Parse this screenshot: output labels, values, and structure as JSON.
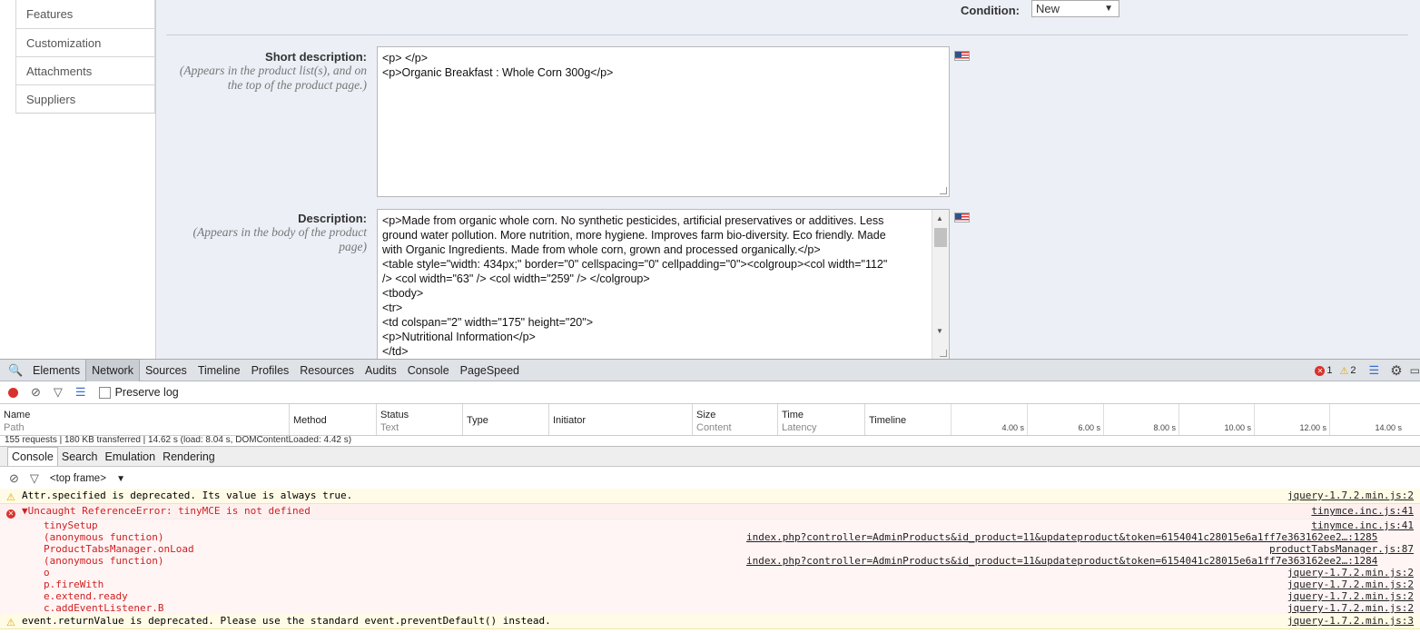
{
  "sidebar": {
    "items": [
      "Features",
      "Customization",
      "Attachments",
      "Suppliers"
    ]
  },
  "form": {
    "condition_label": "Condition:",
    "condition_value": "New",
    "short_desc_label": "Short description:",
    "short_desc_hint": "(Appears in the product list(s), and on the top of the product page.)",
    "short_desc_lines": [
      "<p> </p>",
      "<p>Organic Breakfast : Whole Corn 300g</p>"
    ],
    "desc_label": "Description:",
    "desc_hint": "(Appears in the body of the product page)",
    "desc_lines": [
      "<p>Made from organic whole corn. No synthetic pesticides, artificial preservatives or additives. Less",
      "ground water pollution. More nutrition, more hygiene. Improves farm bio-diversity. Eco friendly. Made",
      "with Organic Ingredients. Made from whole corn, grown and processed organically.</p>",
      "<table style=\"width: 434px;\" border=\"0\" cellspacing=\"0\" cellpadding=\"0\"><colgroup><col width=\"112\"",
      "/> <col width=\"63\" /> <col width=\"259\" /> </colgroup>",
      "<tbody>",
      "<tr>",
      "<td colspan=\"2\" width=\"175\" height=\"20\">",
      "<p>Nutritional Information</p>",
      "</td>"
    ]
  },
  "devtools": {
    "tabs": [
      "Elements",
      "Network",
      "Sources",
      "Timeline",
      "Profiles",
      "Resources",
      "Audits",
      "Console",
      "PageSpeed"
    ],
    "active_tab": "Network",
    "error_count": "1",
    "warning_count": "2",
    "preserve_log": "Preserve log",
    "columns": {
      "name": "Name",
      "path": "Path",
      "method": "Method",
      "status": "Status",
      "text": "Text",
      "type": "Type",
      "initiator": "Initiator",
      "size": "Size",
      "content": "Content",
      "time": "Time",
      "latency": "Latency",
      "timeline": "Timeline"
    },
    "ticks": [
      "4.00 s",
      "6.00 s",
      "8.00 s",
      "10.00 s",
      "12.00 s",
      "14.00 s"
    ],
    "summary": "155 requests | 180 KB transferred | 14.62 s (load: 8.04 s, DOMContentLoaded: 4.42 s)",
    "drawer_tabs": [
      "Console",
      "Search",
      "Emulation",
      "Rendering"
    ],
    "frame": "<top frame>",
    "log": [
      {
        "kind": "warn",
        "text": "Attr.specified is deprecated. Its value is always true.",
        "src": "jquery-1.7.2.min.js:2"
      },
      {
        "kind": "error",
        "text": "▼Uncaught ReferenceError: tinyMCE is not defined",
        "src": "tinymce.inc.js:41"
      },
      {
        "kind": "frame",
        "text": "tinySetup",
        "src": "tinymce.inc.js:41"
      },
      {
        "kind": "frame",
        "text": "(anonymous function)",
        "mid": "index.php?controller=AdminProducts&id_product=11&updateproduct&token=6154041c28015e6a1ff7e363162ee2…:1285"
      },
      {
        "kind": "frame",
        "text": "ProductTabsManager.onLoad",
        "src": "productTabsManager.js:87"
      },
      {
        "kind": "frame",
        "text": "(anonymous function)",
        "mid": "index.php?controller=AdminProducts&id_product=11&updateproduct&token=6154041c28015e6a1ff7e363162ee2…:1284"
      },
      {
        "kind": "frame",
        "text": "o",
        "src": "jquery-1.7.2.min.js:2"
      },
      {
        "kind": "frame",
        "text": "p.fireWith",
        "src": "jquery-1.7.2.min.js:2"
      },
      {
        "kind": "frame",
        "text": "e.extend.ready",
        "src": "jquery-1.7.2.min.js:2"
      },
      {
        "kind": "frame",
        "text": "c.addEventListener.B",
        "src": "jquery-1.7.2.min.js:2"
      },
      {
        "kind": "warn",
        "text": "event.returnValue is deprecated. Please use the standard event.preventDefault() instead.",
        "src": "jquery-1.7.2.min.js:3"
      }
    ]
  }
}
